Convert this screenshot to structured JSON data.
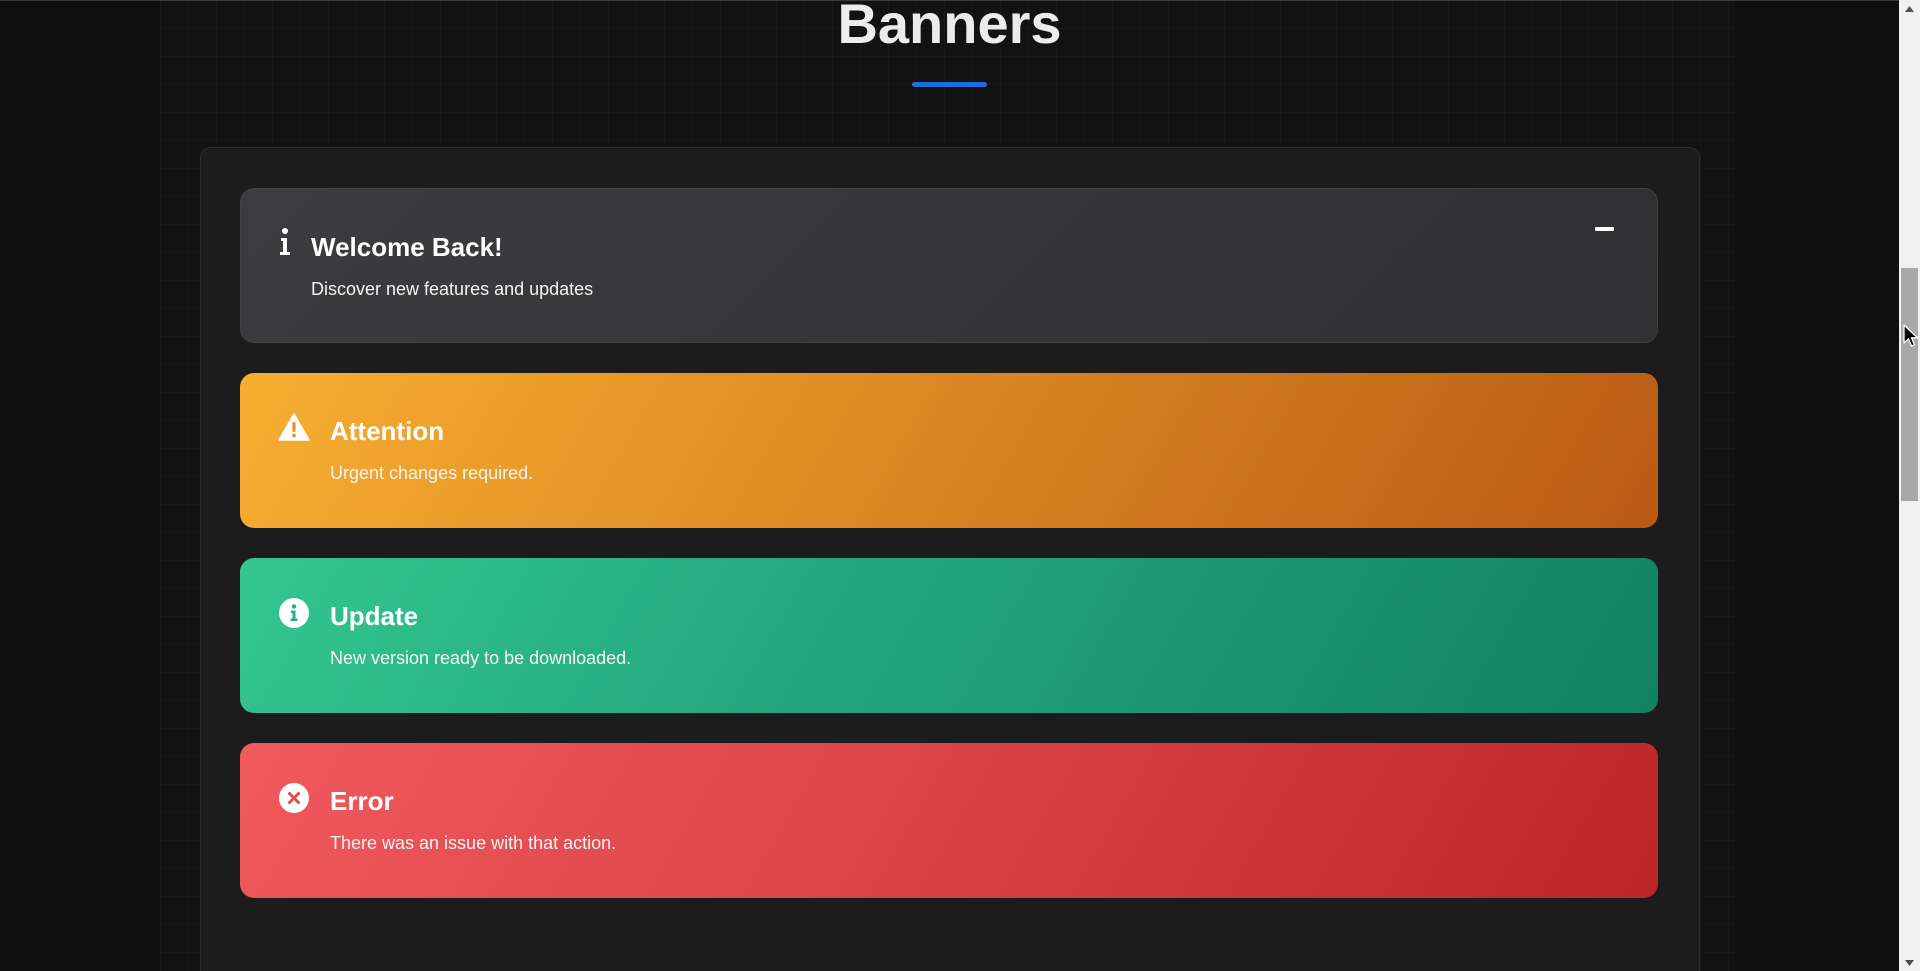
{
  "page": {
    "title": "Banners"
  },
  "colors": {
    "accent_underline": "#1d6fe0",
    "welcome_bg": "#3c3c3e",
    "attention_bg": "#f7ae31",
    "update_bg": "#33c691",
    "error_bg": "#f0595d"
  },
  "banners": [
    {
      "type": "info",
      "icon": "info-icon",
      "title": "Welcome Back!",
      "message": "Discover new features and updates",
      "minimize_icon": "minus-icon"
    },
    {
      "type": "warning",
      "icon": "warning-triangle-icon",
      "title": "Attention",
      "message": "Urgent changes required."
    },
    {
      "type": "success",
      "icon": "info-circle-icon",
      "title": "Update",
      "message": "New version ready to be downloaded."
    },
    {
      "type": "error",
      "icon": "x-circle-icon",
      "title": "Error",
      "message": "There was an issue with that action."
    }
  ],
  "scrollbar": {
    "up_icon": "scroll-up-arrow-icon",
    "down_icon": "scroll-down-arrow-icon"
  }
}
